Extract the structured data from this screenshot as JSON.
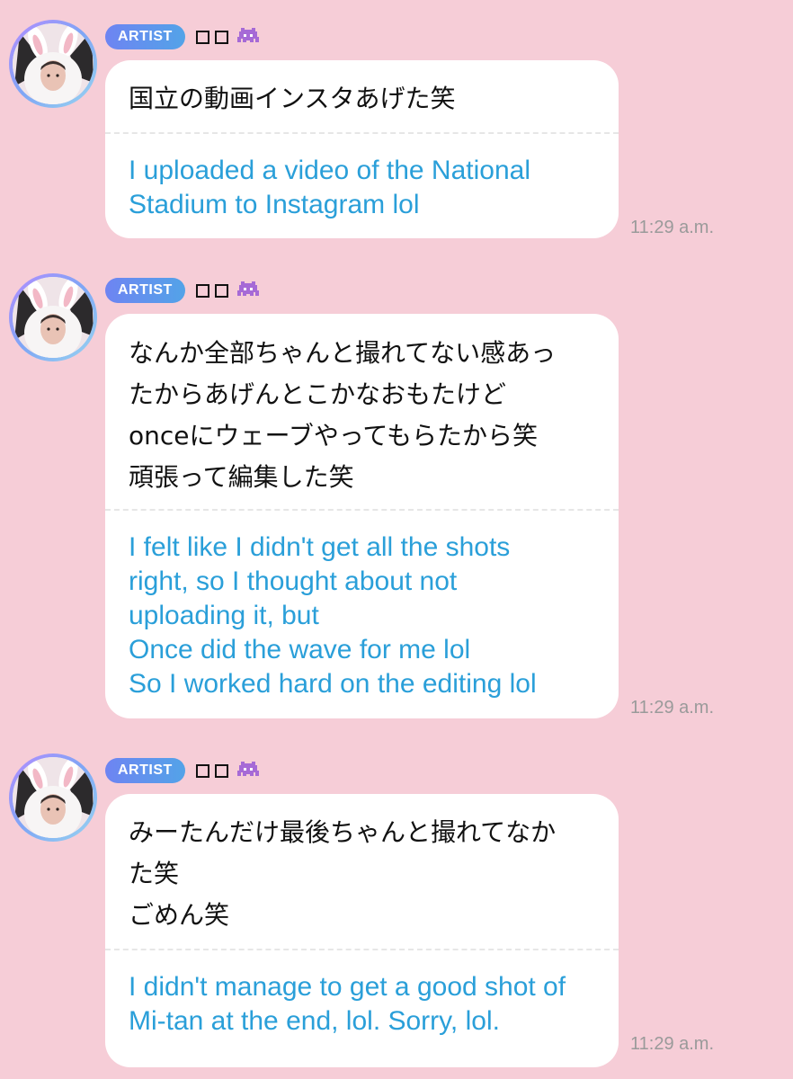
{
  "messages": [
    {
      "badge": "ARTIST",
      "text_jp": "国立の動画インスタあげた笑",
      "text_en": "I uploaded a video of the National\nStadium to Instagram lol",
      "time": "11:29 a.m."
    },
    {
      "badge": "ARTIST",
      "text_jp": "なんか全部ちゃんと撮れてない感あっ\nたからあげんとこかなおもたけど\nonceにウェーブやってもらたから笑\n頑張って編集した笑",
      "text_en": "I felt like I didn't get all the shots\nright, so I thought about not\nuploading it, but\nOnce did the wave for me lol\nSo I worked hard on the editing lol",
      "time": "11:29 a.m."
    },
    {
      "badge": "ARTIST",
      "text_jp": "みーたんだけ最後ちゃんと撮れてなか\nた笑\nごめん笑",
      "text_en": "I didn't manage to get a good shot of\nMi-tan at the end, lol. Sorry, lol.",
      "time": "11:29 a.m."
    }
  ],
  "icons": {
    "sender_name_glyphs": [
      "box-glyph",
      "box-glyph"
    ],
    "sender_emoji": "alien-monster-icon"
  },
  "colors": {
    "background": "#f6cdd7",
    "bubble": "#ffffff",
    "translation_text": "#2a9fd9",
    "badge_gradient_start": "#6e84f2",
    "badge_gradient_end": "#53a3e8",
    "timestamp": "#9a9a9a",
    "alien": "#a66ad6"
  }
}
